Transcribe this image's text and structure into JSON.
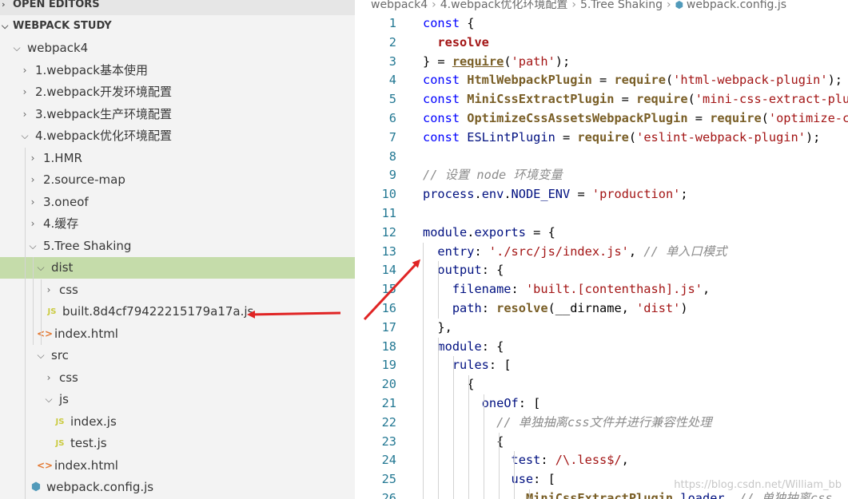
{
  "sidebar": {
    "open_editors": "OPEN EDITORS",
    "workspace": "WEBPACK STUDY",
    "tree": [
      {
        "label": "webpack4",
        "twist": "⌵",
        "icon": ""
      },
      {
        "label": "1.webpack基本使用",
        "twist": "›",
        "icon": ""
      },
      {
        "label": "2.webpack开发环境配置",
        "twist": "›",
        "icon": ""
      },
      {
        "label": "3.webpack生产环境配置",
        "twist": "›",
        "icon": ""
      },
      {
        "label": "4.webpack优化环境配置",
        "twist": "⌵",
        "icon": ""
      },
      {
        "label": "1.HMR",
        "twist": "›",
        "icon": ""
      },
      {
        "label": "2.source-map",
        "twist": "›",
        "icon": ""
      },
      {
        "label": "3.oneof",
        "twist": "›",
        "icon": ""
      },
      {
        "label": "4.缓存",
        "twist": "›",
        "icon": ""
      },
      {
        "label": "5.Tree Shaking",
        "twist": "⌵",
        "icon": ""
      },
      {
        "label": "dist",
        "twist": "⌵",
        "icon": ""
      },
      {
        "label": "css",
        "twist": "›",
        "icon": ""
      },
      {
        "label": "built.8d4cf79422215179a17a.js",
        "twist": "",
        "icon": "JS"
      },
      {
        "label": "index.html",
        "twist": "",
        "icon": "<>"
      },
      {
        "label": "src",
        "twist": "⌵",
        "icon": ""
      },
      {
        "label": "css",
        "twist": "›",
        "icon": ""
      },
      {
        "label": "js",
        "twist": "⌵",
        "icon": ""
      },
      {
        "label": "index.js",
        "twist": "",
        "icon": "JS"
      },
      {
        "label": "test.js",
        "twist": "",
        "icon": "JS"
      },
      {
        "label": "index.html",
        "twist": "",
        "icon": "<>"
      },
      {
        "label": "webpack.config.js",
        "twist": "",
        "icon": "⬢"
      }
    ]
  },
  "breadcrumb": {
    "parts": [
      "webpack4",
      "4.webpack优化环境配置",
      "5.Tree Shaking",
      "webpack.config.js"
    ],
    "separator": "›"
  },
  "editor": {
    "lines": [
      {
        "n": "1",
        "t": [
          [
            "kw",
            "const"
          ],
          [
            "punc",
            " {"
          ]
        ]
      },
      {
        "n": "2",
        "t": [
          [
            "punc",
            "  "
          ],
          [
            "key",
            "resolve"
          ]
        ]
      },
      {
        "n": "3",
        "t": [
          [
            "punc",
            "} = "
          ],
          [
            "fn",
            "require"
          ],
          [
            "punc",
            "("
          ],
          [
            "str",
            "'path'"
          ],
          [
            "punc",
            ");"
          ]
        ]
      },
      {
        "n": "4",
        "t": [
          [
            "kw",
            "const "
          ],
          [
            "fn",
            "HtmlWebpackPlugin"
          ],
          [
            "punc",
            " = "
          ],
          [
            "fn",
            "require"
          ],
          [
            "punc",
            "("
          ],
          [
            "str",
            "'html-webpack-plugin'"
          ],
          [
            "punc",
            ");"
          ]
        ]
      },
      {
        "n": "5",
        "t": [
          [
            "kw",
            "const "
          ],
          [
            "fn",
            "MiniCssExtractPlugin"
          ],
          [
            "punc",
            " = "
          ],
          [
            "fn",
            "require"
          ],
          [
            "punc",
            "("
          ],
          [
            "str",
            "'mini-css-extract-plugin'"
          ],
          [
            "punc",
            ");"
          ]
        ]
      },
      {
        "n": "6",
        "t": [
          [
            "kw",
            "const "
          ],
          [
            "fn",
            "OptimizeCssAssetsWebpackPlugin"
          ],
          [
            "punc",
            " = "
          ],
          [
            "fn",
            "require"
          ],
          [
            "punc",
            "("
          ],
          [
            "str",
            "'optimize-css-assets-webpack-plugin'"
          ],
          [
            "punc",
            ");"
          ]
        ]
      },
      {
        "n": "7",
        "t": [
          [
            "kw",
            "const "
          ],
          [
            "prop",
            "ESLintPlugin"
          ],
          [
            "punc",
            " = "
          ],
          [
            "fn",
            "require"
          ],
          [
            "punc",
            "("
          ],
          [
            "str",
            "'eslint-webpack-plugin'"
          ],
          [
            "punc",
            ");"
          ]
        ]
      },
      {
        "n": "8",
        "t": []
      },
      {
        "n": "9",
        "t": [
          [
            "cm",
            "// 设置 node 环境变量"
          ]
        ]
      },
      {
        "n": "10",
        "t": [
          [
            "prop",
            "process"
          ],
          [
            "punc",
            "."
          ],
          [
            "prop",
            "env"
          ],
          [
            "punc",
            "."
          ],
          [
            "prop",
            "NODE_ENV"
          ],
          [
            "punc",
            " = "
          ],
          [
            "str",
            "'production'"
          ],
          [
            "punc",
            ";"
          ]
        ]
      },
      {
        "n": "11",
        "t": []
      },
      {
        "n": "12",
        "t": [
          [
            "prop",
            "module"
          ],
          [
            "punc",
            "."
          ],
          [
            "prop",
            "exports"
          ],
          [
            "punc",
            " = {"
          ]
        ]
      },
      {
        "n": "13",
        "t": [
          [
            "punc",
            "  "
          ],
          [
            "prop",
            "entry"
          ],
          [
            "punc",
            ": "
          ],
          [
            "str",
            "'./src/js/index.js'"
          ],
          [
            "punc",
            ", "
          ],
          [
            "cm",
            "// 单入口模式"
          ]
        ]
      },
      {
        "n": "14",
        "t": [
          [
            "punc",
            "  "
          ],
          [
            "prop",
            "output"
          ],
          [
            "punc",
            ": {"
          ]
        ]
      },
      {
        "n": "15",
        "t": [
          [
            "punc",
            "    "
          ],
          [
            "prop",
            "filename"
          ],
          [
            "punc",
            ": "
          ],
          [
            "str",
            "'built.[contenthash].js'"
          ],
          [
            "punc",
            ","
          ]
        ]
      },
      {
        "n": "16",
        "t": [
          [
            "punc",
            "    "
          ],
          [
            "prop",
            "path"
          ],
          [
            "punc",
            ": "
          ],
          [
            "fn",
            "resolve"
          ],
          [
            "punc",
            "(__dirname, "
          ],
          [
            "str",
            "'dist'"
          ],
          [
            "punc",
            ")"
          ]
        ]
      },
      {
        "n": "17",
        "t": [
          [
            "punc",
            "  },"
          ]
        ]
      },
      {
        "n": "18",
        "t": [
          [
            "punc",
            "  "
          ],
          [
            "prop",
            "module"
          ],
          [
            "punc",
            ": {"
          ]
        ]
      },
      {
        "n": "19",
        "t": [
          [
            "punc",
            "    "
          ],
          [
            "prop",
            "rules"
          ],
          [
            "punc",
            ": ["
          ]
        ]
      },
      {
        "n": "20",
        "t": [
          [
            "punc",
            "      {"
          ]
        ]
      },
      {
        "n": "21",
        "t": [
          [
            "punc",
            "        "
          ],
          [
            "prop",
            "oneOf"
          ],
          [
            "punc",
            ": ["
          ]
        ]
      },
      {
        "n": "22",
        "t": [
          [
            "punc",
            "          "
          ],
          [
            "cm",
            "// 单独抽离css文件并进行兼容性处理"
          ]
        ]
      },
      {
        "n": "23",
        "t": [
          [
            "punc",
            "          {"
          ]
        ]
      },
      {
        "n": "24",
        "t": [
          [
            "punc",
            "            "
          ],
          [
            "prop",
            "test"
          ],
          [
            "punc",
            ": "
          ],
          [
            "str",
            "/\\.less$/"
          ],
          [
            "punc",
            ","
          ]
        ]
      },
      {
        "n": "25",
        "t": [
          [
            "punc",
            "            "
          ],
          [
            "prop",
            "use"
          ],
          [
            "punc",
            ": ["
          ]
        ]
      },
      {
        "n": "26",
        "t": [
          [
            "punc",
            "              "
          ],
          [
            "fn",
            "MiniCssExtractPlugin"
          ],
          [
            "punc",
            "."
          ],
          [
            "prop",
            "loader"
          ],
          [
            "punc",
            ", "
          ],
          [
            "cm",
            "// 单独抽离css"
          ]
        ]
      }
    ]
  },
  "watermark": "https://blog.csdn.net/William_bb",
  "colors": {
    "sidebar_bg": "#f3f3f3",
    "selected_row": "#c5dcaa",
    "arrow": "#e02424",
    "keyword": "#0000ff",
    "string": "#a31515",
    "comment": "#8c8c8c"
  }
}
